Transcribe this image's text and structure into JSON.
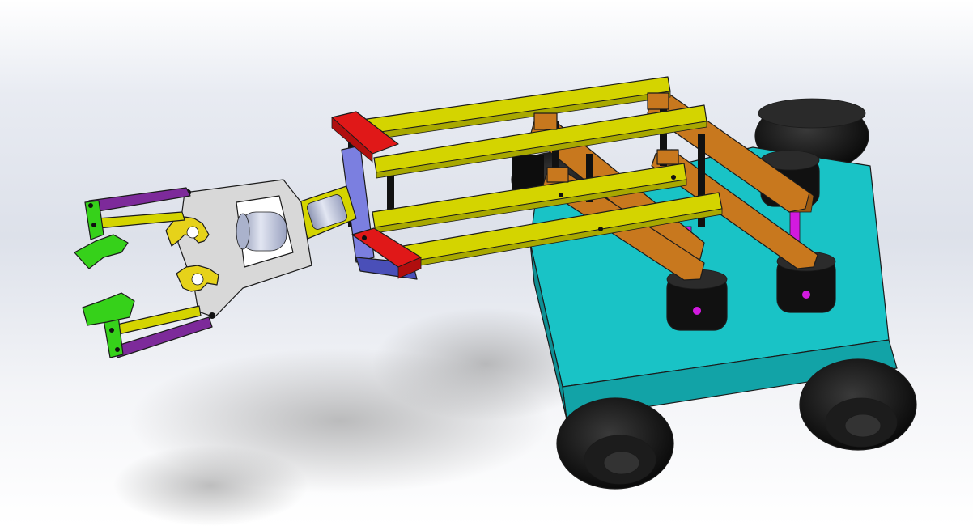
{
  "scene": {
    "description_visible_text": "",
    "colors": {
      "background_top": "#dfe3ec",
      "background_bottom": "#ffffff",
      "chassis_top": "#19c3c6",
      "chassis_side": "#0e8f93",
      "chassis_front": "#12a9ad",
      "wheel": "#111111",
      "wheel_hub": "#2a2a2a",
      "yellow_link": "#d4d400",
      "yellow_link_dark": "#a8a800",
      "orange_link": "#c8781e",
      "orange_link_dark": "#9a5a12",
      "red_block": "#e01818",
      "blue_plate": "#7b7fe0",
      "blue_plate_dark": "#4a4fb8",
      "gray_frame": "#d8d8d8",
      "gray_frame_dark": "#a9a9a9",
      "cylinder": "#b8c0d8",
      "gear": "#e6d21a",
      "finger_green": "#36d11a",
      "finger_purple": "#7d2a9a",
      "magenta_rod": "#d21adf",
      "black_pin": "#111111"
    },
    "icons": {
      "chassis": "robot-chassis-block",
      "arm": "parallel-link-arm",
      "gripper": "gear-driven-gripper"
    }
  }
}
